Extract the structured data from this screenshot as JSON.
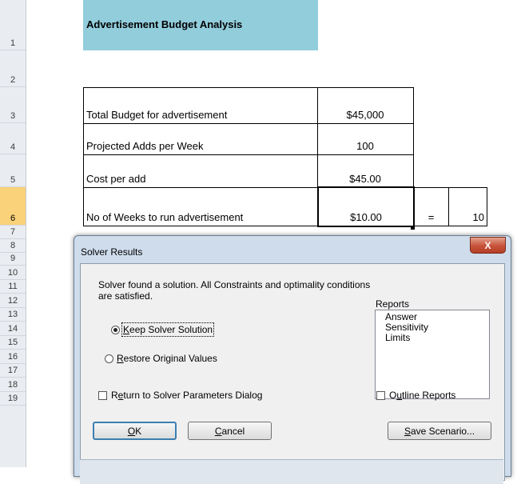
{
  "sheet": {
    "row_numbers": [
      "1",
      "2",
      "3",
      "4",
      "5",
      "6",
      "7",
      "8",
      "9",
      "10",
      "11",
      "12",
      "13",
      "14",
      "15",
      "16",
      "17",
      "18",
      "19"
    ],
    "title": "Advertisement Budget Analysis",
    "rows": [
      {
        "label": "Total Budget for advertisement",
        "value": "$45,000"
      },
      {
        "label": "Projected Adds per Week",
        "value": "100"
      },
      {
        "label": "Cost per add",
        "value": "$45.00"
      },
      {
        "label": "No of Weeks to run advertisement",
        "value": "$10.00",
        "equals": "=",
        "result": "10"
      }
    ]
  },
  "dialog": {
    "title": "Solver Results",
    "close_label": "X",
    "message": "Solver found a solution.  All Constraints and optimality conditions are satisfied.",
    "reports_label": "Reports",
    "reports": [
      "Answer",
      "Sensitivity",
      "Limits"
    ],
    "keep_prefix": "",
    "keep_key": "K",
    "keep_rest": "eep Solver Solution",
    "restore_key": "R",
    "restore_rest": "estore Original Values",
    "return_pre": "R",
    "return_key": "e",
    "return_rest": "turn to Solver Parameters Dialog",
    "outline_pre": "O",
    "outline_key": "u",
    "outline_rest": "tline Reports",
    "ok_key": "O",
    "ok_rest": "K",
    "cancel_key": "C",
    "cancel_rest": "ancel",
    "save_key": "S",
    "save_rest": "ave Scenario..."
  }
}
